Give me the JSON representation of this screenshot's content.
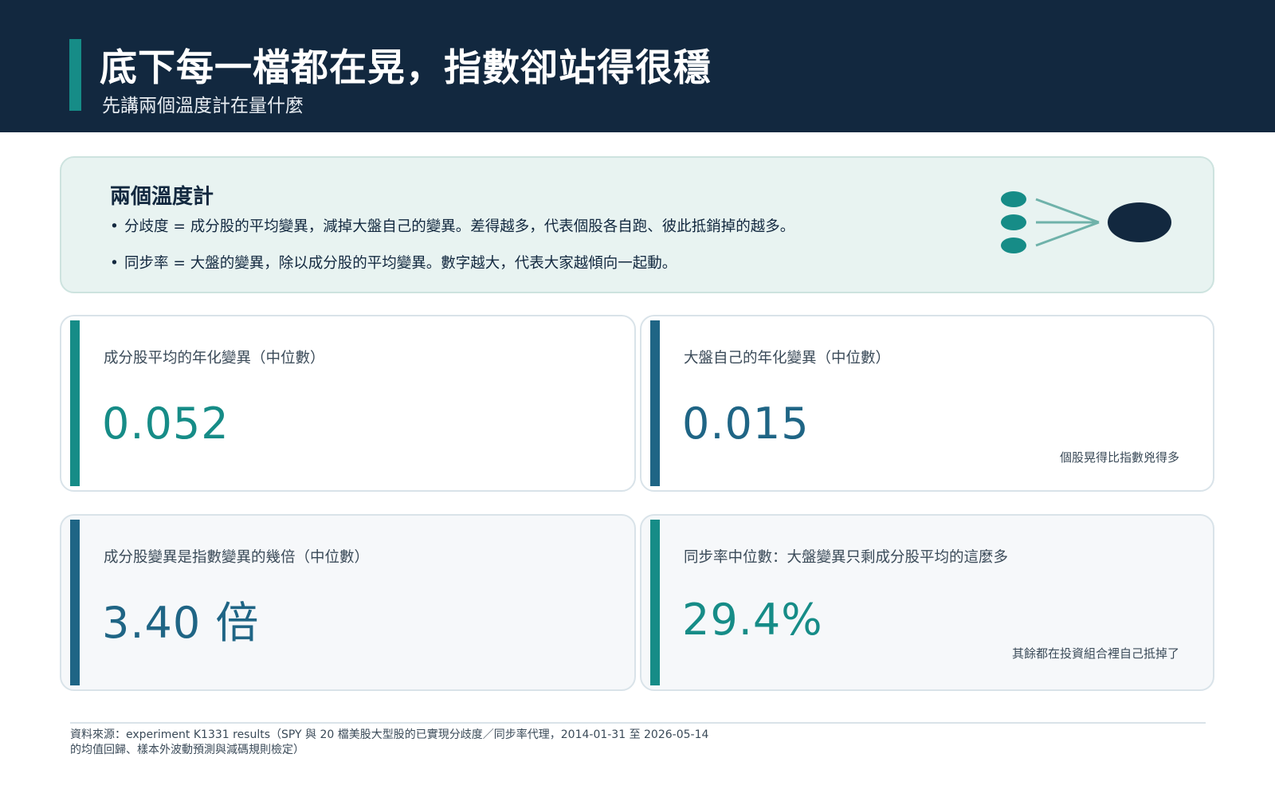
{
  "header": {
    "title": "底下每一檔都在晃，指數卻站得很穩",
    "subtitle": "先講兩個溫度計在量什麼"
  },
  "intro": {
    "heading": "兩個溫度計",
    "bullets": [
      "分歧度 = 成分股的平均變異，減掉大盤自己的變異。差得越多，代表個股各自跑、彼此抵銷掉的越多。",
      "同步率 = 大盤的變異，除以成分股的平均變異。數字越大，代表大家越傾向一起動。"
    ]
  },
  "cards": [
    {
      "label": "成分股平均的年化變異（中位數）",
      "value": "0.052",
      "note": ""
    },
    {
      "label": "大盤自己的年化變異（中位數）",
      "value": "0.015",
      "note": "個股晃得比指數兇得多"
    },
    {
      "label": "成分股變異是指數變異的幾倍（中位數）",
      "value": "3.40 倍",
      "note": ""
    },
    {
      "label": "同步率中位數：大盤變異只剩成分股平均的這麼多",
      "value": "29.4%",
      "note": "其餘都在投資組合裡自己抵掉了"
    }
  ],
  "footer": {
    "source_line1": "資料來源：experiment K1331 results（SPY 與 20 檔美股大型股的已實現分歧度／同步率代理，2014-01-31 至 2026-05-14",
    "source_line2": "的均值回歸、樣本外波動預測與減碼規則檢定）"
  },
  "colors": {
    "navy": "#12283f",
    "teal": "#168c87",
    "blue": "#1f6585",
    "mint_bg": "#e8f3f1"
  }
}
